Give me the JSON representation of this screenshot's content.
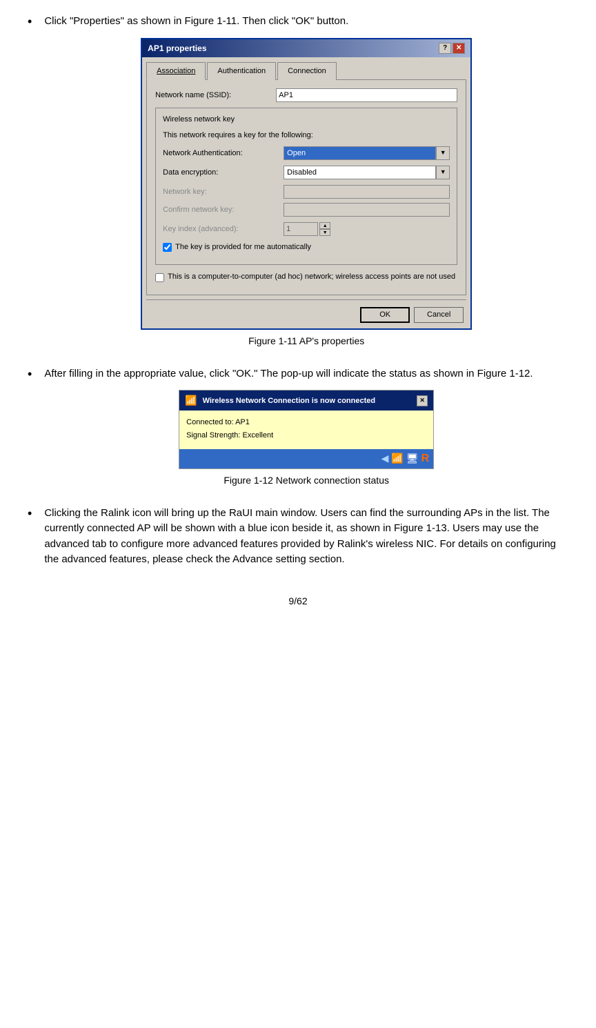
{
  "bullets": [
    {
      "id": "bullet1",
      "text": "Click \"Properties\" as shown in Figure 1-11. Then click \"OK\" button."
    },
    {
      "id": "bullet2",
      "text_before": "After filling in the appropriate value, click \"OK.\" The pop-up will indicate the status as shown in Figure 1-12."
    },
    {
      "id": "bullet3",
      "text": "Clicking the Ralink icon will bring up the RaUI main window. Users can find the surrounding APs in the list. The currently connected AP will be shown with a blue icon beside it, as shown in Figure 1-13. Users may use the advanced tab to configure more advanced features provided by Ralink's wireless NIC. For details on configuring the advanced features, please check the Advance setting section."
    }
  ],
  "dialog": {
    "title": "AP1 properties",
    "tabs": [
      "Association",
      "Authentication",
      "Connection"
    ],
    "active_tab": "Association",
    "network_name_label": "Network name (SSID):",
    "network_name_value": "AP1",
    "wireless_key_legend": "Wireless network key",
    "wireless_key_desc": "This network requires a key for the following:",
    "network_auth_label": "Network Authentication:",
    "network_auth_value": "Open",
    "data_enc_label": "Data encryption:",
    "data_enc_value": "Disabled",
    "network_key_label": "Network key:",
    "confirm_key_label": "Confirm network key:",
    "key_index_label": "Key index (advanced):",
    "key_index_value": "1",
    "auto_key_label": "The key is provided for me automatically",
    "ad_hoc_label": "This is a computer-to-computer (ad hoc) network; wireless access points are not used",
    "ok_label": "OK",
    "cancel_label": "Cancel"
  },
  "figure1": {
    "caption": "Figure 1-11 AP's properties"
  },
  "popup": {
    "header": "Wireless Network Connection is now connected",
    "connected_to": "Connected to: AP1",
    "signal_strength": "Signal Strength: Excellent"
  },
  "figure2": {
    "caption": "Figure 1-12 Network connection status"
  },
  "page": {
    "number": "9/62"
  }
}
